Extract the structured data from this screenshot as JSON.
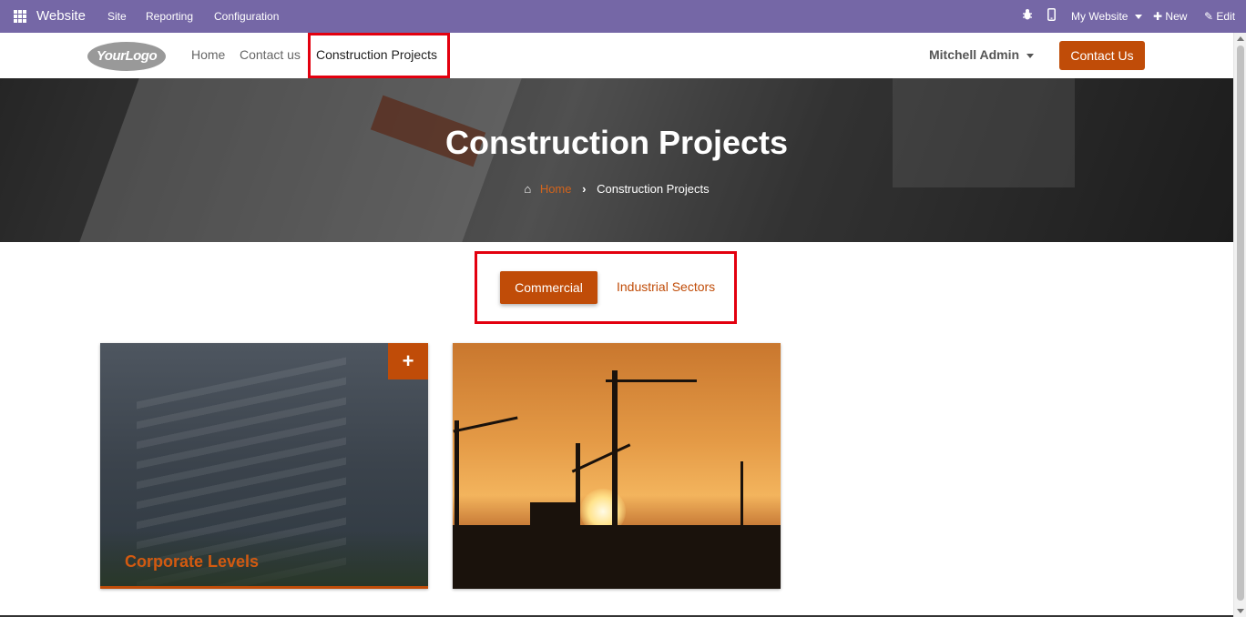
{
  "topbar": {
    "app_name": "Website",
    "menu": [
      "Site",
      "Reporting",
      "Configuration"
    ],
    "website_switcher": "My Website",
    "new_label": "New",
    "edit_label": "Edit"
  },
  "header": {
    "logo_text": "YourLogo",
    "nav": [
      "Home",
      "Contact us",
      "Construction Projects"
    ],
    "user_name": "Mitchell Admin",
    "cta_label": "Contact Us"
  },
  "hero": {
    "title": "Construction Projects",
    "breadcrumb_home": "Home",
    "breadcrumb_current": "Construction Projects"
  },
  "filters": {
    "active": "Commercial",
    "other": "Industrial Sectors"
  },
  "cards": [
    {
      "label": "Corporate Levels",
      "icon": "plus-icon"
    },
    {
      "label": "",
      "icon": ""
    }
  ],
  "colors": {
    "odoo_bar": "#7567a6",
    "accent": "#c04c08",
    "highlight": "#e3000f"
  }
}
